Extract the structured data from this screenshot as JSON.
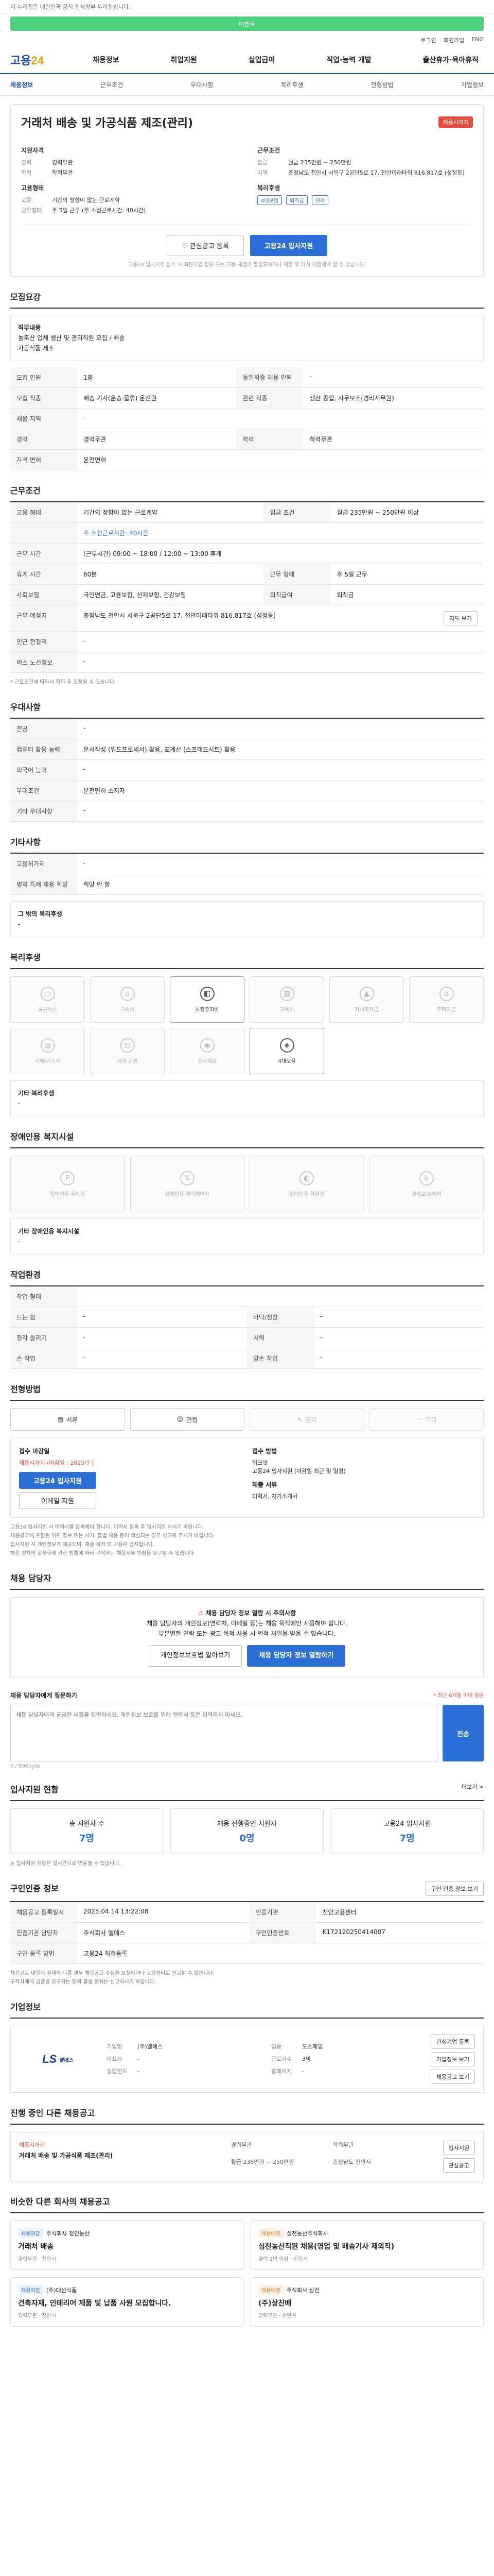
{
  "top": {
    "notice": "이 누리집은 대한민국 공식 전자정부 누리집입니다.",
    "banner": "이벤트",
    "util": [
      "로그인",
      "회원가입",
      "ENG"
    ]
  },
  "gnb": {
    "logo_a": "고용",
    "logo_b": "24",
    "menu": [
      "채용정보",
      "취업지원",
      "실업급여",
      "직업·능력 개발",
      "출산휴가·육아휴직"
    ]
  },
  "lnb": [
    "채용정보",
    "근무조건",
    "우대사항",
    "복리후생",
    "전형방법",
    "기업정보"
  ],
  "job": {
    "title": "거래처 배송 및 가공식품 제조(관리)",
    "badge": "채용시까지",
    "left_group_1": "지원자격",
    "left_kv": [
      {
        "k": "경력",
        "v": "경력무관"
      },
      {
        "k": "학력",
        "v": "학력무관"
      }
    ],
    "left_group_2": "고용형태",
    "left_kv2": [
      {
        "k": "고용",
        "v": "기간의 정함이 없는 근로계약"
      },
      {
        "k": "근무형태",
        "v": "주 5일 근무 (주 소정근로시간: 40시간)"
      }
    ],
    "right_group_1": "근무조건",
    "right_kv": [
      {
        "k": "임금",
        "v": "월급 235만원 ~ 250만원"
      },
      {
        "k": "지역",
        "v": "충청남도 천안시 서북구 2공단5로 17, 천안미래타워 816,817호 (성정동)"
      }
    ],
    "right_group_2": "복리후생",
    "benefits": [
      "4대보험",
      "퇴직금",
      "연차"
    ],
    "btn_scrap": "관심공고 등록",
    "btn_apply": "고용24 입사지원",
    "apply_note": "고용24 입사지원 접수 시 회원가입 필요 또는 고용 제출이 불필요하거나 제출 후 다시 제출해야 할 수 있습니다."
  },
  "recruit": {
    "heading": "모집요강",
    "box_title": "직무내용",
    "box_text": "농축산 업체 생산 및 관리직원 모집 / 배송",
    "box_sub": "가공식품 제조",
    "rows": [
      {
        "k1": "모집 인원",
        "v1": "1명",
        "k2": "동일직종 채용 인원",
        "v2": "-"
      },
      {
        "k1": "모집 직종",
        "v1": "배송 기사(운송·물류) 운전원",
        "k2": "관련 직종",
        "v2": "생산 종업, 사무보조(경리사무원)"
      },
      {
        "k1": "채용 지역",
        "v1": "-",
        "k2": "",
        "v2": ""
      },
      {
        "k1": "경력",
        "v1": "경력무관",
        "k2": "학력",
        "v2": "학력무관"
      },
      {
        "k1": "자격 면허",
        "v1": "운전면허",
        "k2": "",
        "v2": ""
      }
    ]
  },
  "conditions": {
    "heading": "근무조건",
    "rows": [
      {
        "k": "고용 형태",
        "v": "기간의 정함이 없는 근로계약",
        "k2": "임금 조건",
        "v2": "월급 235만원 ~ 250만원 이상"
      },
      {
        "k": "",
        "v": "주 소정근로시간: 40시간",
        "k2": "",
        "v2": ""
      },
      {
        "k": "근무 시간",
        "v": "(근무시간) 09:00 ~ 18:00 / 12:00 ~ 13:00 휴게",
        "k2": "",
        "v2": ""
      },
      {
        "k": "휴게 시간",
        "v": "60분",
        "k2": "근무 형태",
        "v2": "주 5일 근무"
      },
      {
        "k": "사회보험",
        "v": "국민연금, 고용보험, 산재보험, 건강보험",
        "k2": "퇴직급여",
        "v2": "퇴직금"
      },
      {
        "k": "근무 예정지",
        "v": "충청남도 천안시 서북구 2공단5로 17, 천안미래타워 816,817호 (성정동)",
        "k2": "",
        "v2": ""
      },
      {
        "k": "인근 전철역",
        "v": "-",
        "k2": "",
        "v2": ""
      },
      {
        "k": "버스 노선정보",
        "v": "-",
        "k2": "",
        "v2": ""
      }
    ],
    "map_btn": "지도 보기",
    "note": "* 근로조건에 따라서 합의 후 조정될 수 있습니다."
  },
  "prefer": {
    "heading": "우대사항",
    "rows": [
      {
        "k": "전공",
        "v": "-"
      },
      {
        "k": "컴퓨터 활용 능력",
        "v": "문서작성 (워드프로세서) 활용, 표계산 (스프레드시트) 활용"
      },
      {
        "k": "외국어 능력",
        "v": "-"
      },
      {
        "k": "우대조건",
        "v": "운전면허 소지자"
      },
      {
        "k": "기타 우대사항",
        "v": "-"
      }
    ]
  },
  "extra": {
    "heading": "기타사항",
    "rows": [
      {
        "k": "고용허가제",
        "v": "-"
      },
      {
        "k": "병역 특례 채용 희망",
        "v": "희망 안 함"
      }
    ],
    "other_label": "그 밖의 복리후생",
    "other_value": "-"
  },
  "welfare": {
    "heading": "복리후생",
    "items": [
      {
        "label": "통근버스",
        "icon": "bus-icon",
        "on": false
      },
      {
        "label": "기숙사",
        "icon": "house-icon",
        "on": false
      },
      {
        "label": "차량유지비",
        "icon": "car-icon",
        "on": true
      },
      {
        "label": "교육비",
        "icon": "book-icon",
        "on": false
      },
      {
        "label": "자녀학자금",
        "icon": "cap-icon",
        "on": false
      },
      {
        "label": "주택자금",
        "icon": "home-icon",
        "on": false
      },
      {
        "label": "사택/기숙사",
        "icon": "building-icon",
        "on": false
      },
      {
        "label": "식비 지원",
        "icon": "food-icon",
        "on": false
      },
      {
        "label": "중식제공",
        "icon": "meal-icon",
        "on": false
      },
      {
        "label": "4대보험",
        "icon": "shield-icon",
        "on": true
      }
    ],
    "other_label": "기타 복리후생",
    "other_value": "-"
  },
  "disability": {
    "heading": "장애인용 복지시설",
    "items": [
      {
        "label": "장애인용 주차장",
        "icon": "parking-icon"
      },
      {
        "label": "장애인용 엘리베이터",
        "icon": "elevator-icon"
      },
      {
        "label": "장애인용 화장실",
        "icon": "toilet-icon"
      },
      {
        "label": "경사로/휠체어",
        "icon": "wheelchair-icon"
      }
    ],
    "other_label": "기타 장애인용 복지시설",
    "other_value": "-"
  },
  "env": {
    "heading": "작업환경",
    "rows": [
      {
        "k1": "작업 형태",
        "v1": "-",
        "k2": "",
        "v2": ""
      },
      {
        "k1": "드는 힘",
        "v1": "-",
        "k2": "바닥/천장",
        "v2": "-"
      },
      {
        "k1": "청각 들리기",
        "v1": "-",
        "k2": "시력",
        "v2": "-"
      },
      {
        "k1": "손 작업",
        "v1": "-",
        "k2": "양손 작업",
        "v2": "-"
      }
    ]
  },
  "method": {
    "heading": "전형방법",
    "items": [
      {
        "label": "서류",
        "on": true
      },
      {
        "label": "면접",
        "on": true
      },
      {
        "label": "필기",
        "on": false
      },
      {
        "label": "기타",
        "on": false
      }
    ],
    "left_title": "접수 마감일",
    "left_value": "채용시까지 (마감일 : 2025년 )",
    "left_btn1": "고용24 입사지원",
    "left_btn2": "이메일 지원",
    "right_title": "접수 방법",
    "right_lines": [
      "워크넷",
      "고용24 입사지원 (마감일 최근 및 일정)"
    ],
    "right_title2": "제출 서류",
    "right_value2": "이력서, 자기소개서",
    "bullets": [
      "고용24 입사지원 시 이력서를 등록해야 합니다. 이력서 등록 후 입사지원 하시기 바랍니다.",
      "채용공고에 포함된 허위 정보 또는 사기, 불법 채용 등이 의심되는 경우 신고해 주시기 바랍니다.",
      "입사지원 시 개인정보가 제공되며, 채용 목적 외 이용은 금지됩니다.",
      "채용 절차의 공정화에 관한 법률에 따라 구직자는 채용서류 반환을 요구할 수 있습니다."
    ]
  },
  "manager": {
    "heading": "채용 담당자",
    "warn_title": "채용 담당자 정보 열람 시 주의사항",
    "warn_text": "채용 담당자의 개인정보(연락처, 이메일 등)는 채용 목적에만 사용해야 합니다.",
    "warn_text2": "무분별한 연락 또는 광고 목적 사용 시 법적 처벌을 받을 수 있습니다.",
    "btn_report": "개인정보보호법 알아보기",
    "btn_view": "채용 담당자 정보 열람하기"
  },
  "inquiry": {
    "heading": "채용 담당자에게 질문하기",
    "note": "* 최근 6개월 이내 질문",
    "placeholder": "채용 담당자에게 궁금한 내용을 입력하세요. 개인정보 보호를 위해 연락처 등은 입력하지 마세요.",
    "counter": "0 / 500byte",
    "send": "전송"
  },
  "applicants": {
    "heading": "입사지원 현황",
    "more": "더보기 >",
    "stats": [
      {
        "label": "총 지원자 수",
        "value": "7명"
      },
      {
        "label": "채용 진행중인 지원자",
        "value": "0명"
      },
      {
        "label": "고용24 입사지원",
        "value": "7명"
      }
    ],
    "note": "※ 입사지원 현황은 실시간으로 변동될 수 있습니다."
  },
  "meta": {
    "heading": "구인인증 정보",
    "btn": "구인 인증 정보 보기",
    "rows": [
      {
        "k1": "채용공고 등록일시",
        "v1": "2025.04.14 13:22:08",
        "k2": "인증기관",
        "v2": "천안고용센터"
      },
      {
        "k1": "인증기관 담당자",
        "v1": "주식회사 엘에스",
        "k2": "구인인증번호",
        "v2": "K172120250414007"
      },
      {
        "k1": "구인 등록 방법",
        "v1": "고용24 직접등록",
        "k2": "",
        "v2": ""
      }
    ],
    "notes": [
      "채용공고 내용이 실제와 다를 경우 채용공고 수정을 요청하거나 고용센터로 신고할 수 있습니다.",
      "구직자에게 금품을 요구하는 등의 불법 행위는 신고하시기 바랍니다."
    ]
  },
  "company": {
    "heading": "기업정보",
    "logo": "LS",
    "logo_sub": "엘에스",
    "rows": [
      {
        "k": "기업명",
        "v": "(주)엘에스"
      },
      {
        "k": "업종",
        "v": "도소매업"
      },
      {
        "k": "대표자",
        "v": "-"
      },
      {
        "k": "근로자수",
        "v": "3명"
      },
      {
        "k": "설립연도",
        "v": "-"
      },
      {
        "k": "홈페이지",
        "v": "-"
      }
    ],
    "btns": [
      "관심기업 등록",
      "기업정보 보기",
      "채용공고 보기"
    ]
  },
  "others": {
    "heading": "진행 중인 다른 채용공고",
    "title": "거래처 배송 및 가공식품 제조(관리)",
    "label": "채용시까지",
    "meta": [
      "경력무관",
      "학력무관",
      "월급 235만원 ~ 250만원",
      "충청남도 천안시"
    ],
    "btns": [
      "입사지원",
      "관심공고"
    ]
  },
  "similar": {
    "heading": "비슷한 다른 회사의 채용공고",
    "cards": [
      {
        "tag": "채용마감",
        "company": "주식회사 정인농산",
        "title": "거래처 배송",
        "meta": "경력무관 · 천안시",
        "orange": false
      },
      {
        "tag": "채용예정",
        "company": "심천농산주식회사",
        "title": "심천농산직원 채용(영업 및 배송기사 제외직)",
        "meta": "경력 1년 이상 · 천안시",
        "orange": true
      },
      {
        "tag": "채용마감",
        "company": "(주)대선식품",
        "title": "건축자재, 인테리어 제품 및 납품 사원 모집합니다.",
        "meta": "경력무관 · 천안시",
        "orange": false
      },
      {
        "tag": "채용예정",
        "company": "주식회사 상진",
        "title": "(주)상진배",
        "meta": "경력무관 · 천안시",
        "orange": true
      }
    ]
  }
}
